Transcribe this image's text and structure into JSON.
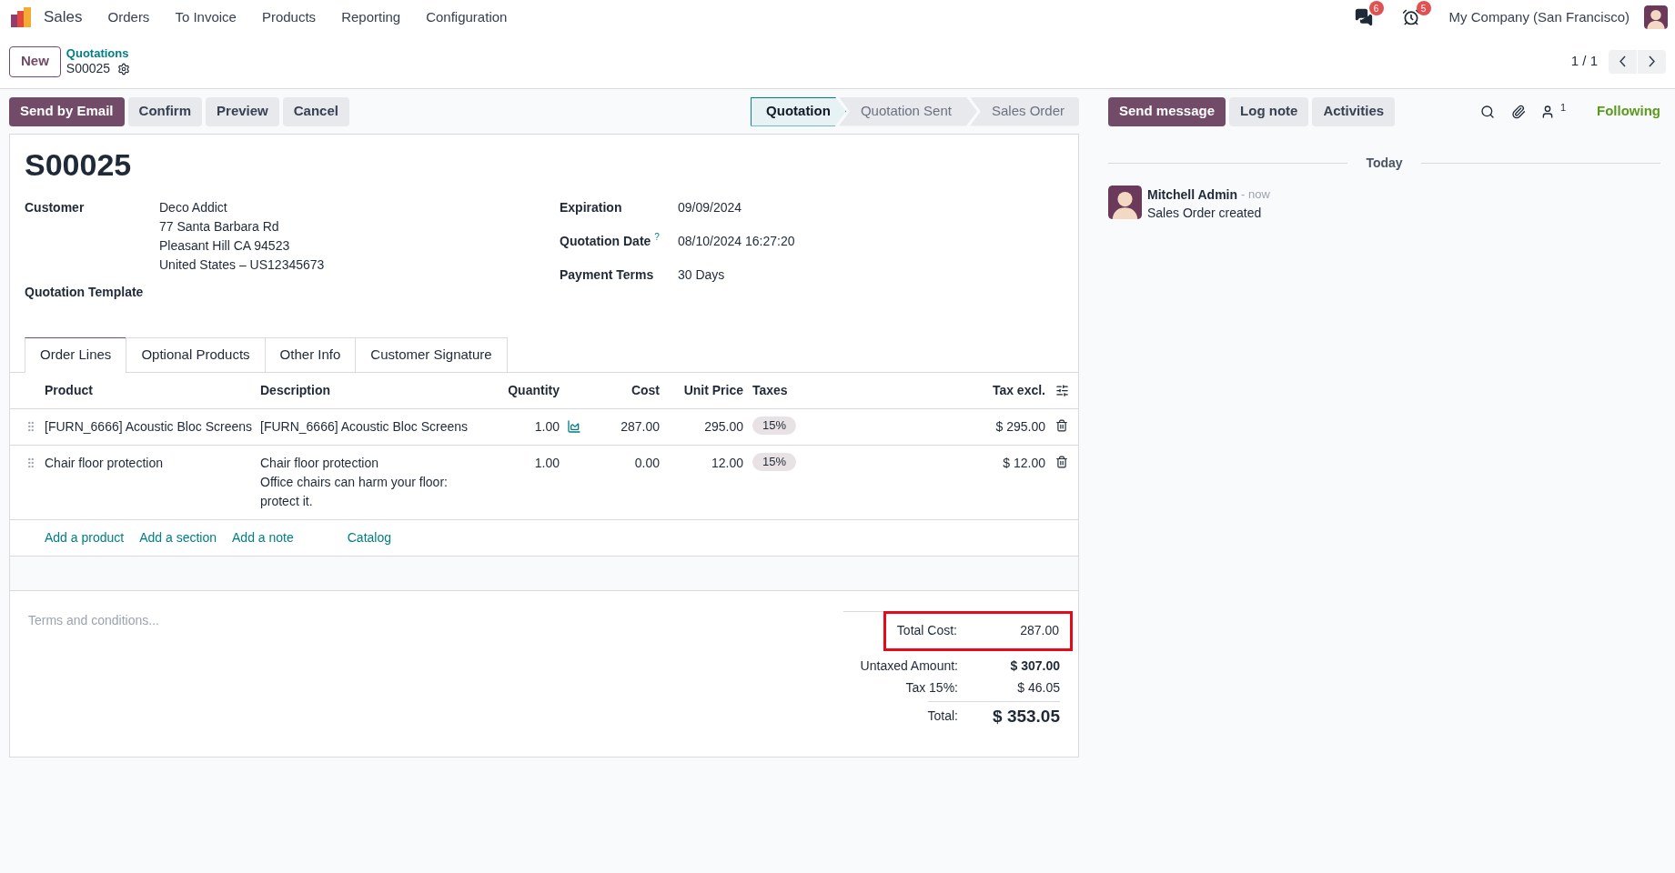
{
  "app": {
    "name": "Sales",
    "menu": [
      "Orders",
      "To Invoice",
      "Products",
      "Reporting",
      "Configuration"
    ]
  },
  "systray": {
    "messages_count": "6",
    "activities_count": "5",
    "company": "My Company (San Francisco)"
  },
  "control_panel": {
    "new_button": "New",
    "breadcrumb": "Quotations",
    "record": "S00025",
    "pager": "1 / 1"
  },
  "actions": [
    {
      "label": "Send by Email",
      "primary": true
    },
    {
      "label": "Confirm",
      "primary": false
    },
    {
      "label": "Preview",
      "primary": false
    },
    {
      "label": "Cancel",
      "primary": false
    }
  ],
  "status_steps": [
    {
      "label": "Quotation",
      "selected": true
    },
    {
      "label": "Quotation Sent",
      "selected": false
    },
    {
      "label": "Sales Order",
      "selected": false
    }
  ],
  "form": {
    "title": "S00025",
    "left_fields": [
      {
        "label": "Customer",
        "lines": [
          "Deco Addict",
          "77 Santa Barbara Rd",
          "Pleasant Hill CA 94523",
          "United States – US12345673"
        ]
      },
      {
        "label": "Quotation Template"
      }
    ],
    "right_fields": [
      {
        "label": "Expiration",
        "value": "09/09/2024"
      },
      {
        "label": "Quotation Date",
        "value": "08/10/2024 16:27:20",
        "help": "?"
      },
      {
        "label": "Payment Terms",
        "value": "30 Days"
      }
    ],
    "tabs": [
      {
        "label": "Order Lines",
        "selected": true
      },
      {
        "label": "Optional Products",
        "selected": false
      },
      {
        "label": "Other Info",
        "selected": false
      },
      {
        "label": "Customer Signature",
        "selected": false
      }
    ],
    "columns": [
      "Product",
      "Description",
      "Quantity",
      "Cost",
      "Unit Price",
      "Taxes",
      "Tax excl."
    ],
    "lines": [
      {
        "product": "[FURN_6666] Acoustic Bloc Screens",
        "description": [
          "[FURN_6666] Acoustic Bloc Screens"
        ],
        "quantity": "1.00",
        "forecast": true,
        "cost": "287.00",
        "unit_price": "295.00",
        "tax": "15%",
        "subtotal": "$ 295.00"
      },
      {
        "product": "Chair floor protection",
        "description": [
          "Chair floor protection",
          "Office chairs can harm your floor:",
          "protect it."
        ],
        "quantity": "1.00",
        "forecast": false,
        "cost": "0.00",
        "unit_price": "12.00",
        "tax": "15%",
        "subtotal": "$ 12.00"
      }
    ],
    "add_links": [
      "Add a product",
      "Add a section",
      "Add a note",
      "Catalog"
    ],
    "terms_placeholder": "Terms and conditions...",
    "totals": [
      {
        "label": "Total Cost:",
        "value": "287.00",
        "kind": "cost",
        "highlighted": true
      },
      {
        "label": "Untaxed Amount:",
        "value": "$ 307.00",
        "kind": "bold",
        "highlighted": false
      },
      {
        "label": "Tax 15%:",
        "value": "$ 46.05",
        "kind": "plain",
        "highlighted": false
      },
      {
        "label": "Total:",
        "value": "$ 353.05",
        "kind": "grand",
        "highlighted": false
      }
    ]
  },
  "chatter": {
    "buttons": [
      {
        "label": "Send message",
        "primary": true
      },
      {
        "label": "Log note",
        "primary": false
      },
      {
        "label": "Activities",
        "primary": false
      }
    ],
    "followers_count": "1",
    "follow_state": "Following",
    "date_separator": "Today",
    "messages": [
      {
        "author": "Mitchell Admin",
        "time": "- now",
        "body": "Sales Order created"
      }
    ]
  }
}
